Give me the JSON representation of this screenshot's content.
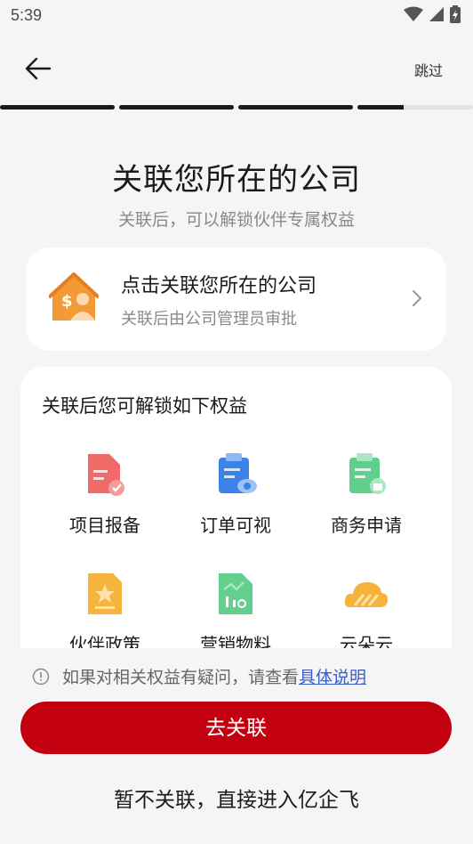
{
  "status": {
    "time": "5:39"
  },
  "nav": {
    "skip_label": "跳过"
  },
  "progress": {
    "segments": [
      1,
      1,
      1,
      0.4,
      0
    ]
  },
  "header": {
    "title": "关联您所在的公司",
    "subtitle": "关联后，可以解锁伙伴专属权益"
  },
  "link_card": {
    "title": "点击关联您所在的公司",
    "subtitle": "关联后由公司管理员审批"
  },
  "benefits": {
    "heading": "关联后您可解锁如下权益",
    "items": [
      {
        "label": "项目报备",
        "icon": "project-report-icon"
      },
      {
        "label": "订单可视",
        "icon": "order-view-icon"
      },
      {
        "label": "商务申请",
        "icon": "business-apply-icon"
      },
      {
        "label": "伙伴政策",
        "icon": "partner-policy-icon"
      },
      {
        "label": "营销物料",
        "icon": "marketing-material-icon"
      },
      {
        "label": "云朵云",
        "icon": "cloud-icon"
      }
    ]
  },
  "notice": {
    "text": "如果对相关权益有疑问，请查看",
    "link": "具体说明"
  },
  "actions": {
    "primary_label": "去关联",
    "secondary_label": "暂不关联，直接进入亿企飞"
  },
  "colors": {
    "accent": "#c3000f",
    "link": "#3a5fc8"
  }
}
